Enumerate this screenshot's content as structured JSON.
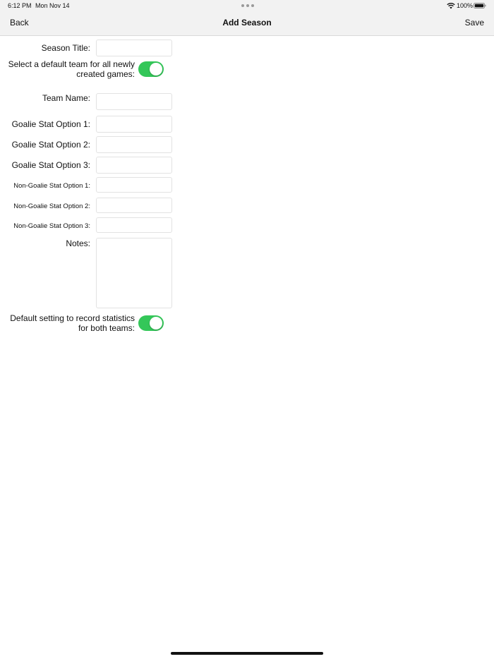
{
  "status_bar": {
    "time": "6:12 PM",
    "date": "Mon Nov 14",
    "battery": "100%",
    "icons": [
      "wifi-icon",
      "battery-icon"
    ]
  },
  "nav": {
    "back_label": "Back",
    "title": "Add Season",
    "save_label": "Save"
  },
  "form": {
    "season_title_label": "Season Title:",
    "season_title_value": "",
    "default_team_label": "Select a default team for all newly created games:",
    "default_team_on": true,
    "team_name_label": "Team Name:",
    "team_name_value": "",
    "goalie_1_label": "Goalie Stat Option 1:",
    "goalie_2_label": "Goalie Stat Option 2:",
    "goalie_3_label": "Goalie Stat Option 3:",
    "non_goalie_1_label": "Non-Goalie Stat Option 1:",
    "non_goalie_2_label": "Non-Goalie Stat Option 2:",
    "non_goalie_3_label": "Non-Goalie Stat Option 3:",
    "notes_label": "Notes:",
    "notes_value": "",
    "record_both_label": "Default setting to record statistics for both teams:",
    "record_both_on": true
  },
  "colors": {
    "toggle_on": "#34c759",
    "bar_background": "#f2f2f2"
  }
}
